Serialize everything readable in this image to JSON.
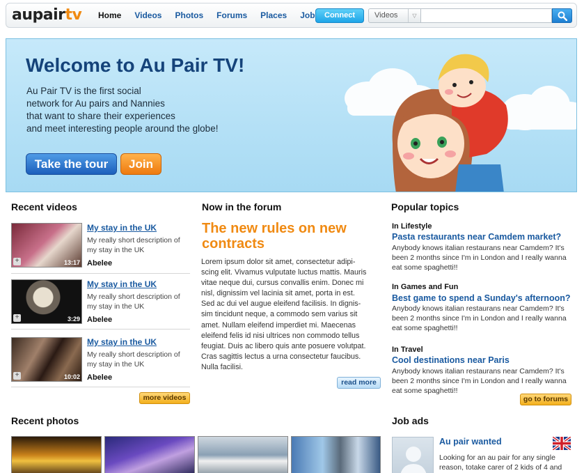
{
  "header": {
    "logo_part1": "aupair",
    "logo_part2": "tv",
    "nav": [
      "Home",
      "Videos",
      "Photos",
      "Forums",
      "Places",
      "Jobs"
    ],
    "connect_label": "Connect",
    "search_type": "Videos"
  },
  "hero": {
    "title": "Welcome to Au Pair TV!",
    "intro": [
      "Au Pair TV is the first social",
      "network for Au pairs and Nannies",
      "that want to share their experiences",
      "and meet interesting people around the globe!"
    ],
    "tour_label": "Take the tour",
    "join_label": "Join"
  },
  "videos": {
    "title": "Recent videos",
    "items": [
      {
        "title": "My stay in the UK",
        "desc": [
          "My really short description of",
          "my stay in the UK"
        ],
        "user": "Abelee",
        "duration": "13:17"
      },
      {
        "title": "My stay in the UK",
        "desc": [
          "My really short description of",
          "my stay in the UK"
        ],
        "user": "Abelee",
        "duration": "3:29"
      },
      {
        "title": "My stay in the UK",
        "desc": [
          "My really short description of",
          "my stay in the UK"
        ],
        "user": "Abelee",
        "duration": "10:02"
      }
    ],
    "more_label": "more videos"
  },
  "forum": {
    "title": "Now in the forum",
    "headline": [
      "The new rules on new",
      "contracts"
    ],
    "body": [
      "Lorem ipsum dolor sit amet, consectetur adipi-",
      "scing elit. Vivamus vulputate luctus mattis. Mauris",
      "vitae neque dui, cursus convallis enim. Donec mi",
      "nisl, dignissim vel lacinia sit amet, porta in est.",
      "Sed ac dui vel augue eleifend facilisis. In dignis-",
      "sim tincidunt neque, a commodo sem varius sit",
      "amet. Nullam eleifend imperdiet mi. Maecenas",
      "eleifend felis id nisi ultrices non commodo tellus",
      "feugiat. Duis ac libero quis ante posuere volutpat.",
      "Cras sagittis lectus a urna consectetur faucibus.",
      "Nulla facilisi."
    ],
    "read_more": "read more"
  },
  "topics": {
    "title": "Popular topics",
    "items": [
      {
        "category": "In Lifestyle",
        "title": "Pasta restaurants near Camdem market?",
        "body": [
          "Anybody knows italian restaurans near Camdem? It's",
          "been 2 months since I'm in London and I really wanna",
          "eat some spaghetti!!"
        ]
      },
      {
        "category": "In Games and Fun",
        "title": "Best game to spend a Sunday's afternoon?",
        "body": [
          "Anybody knows italian restaurans near Camdem? It's",
          "been 2 months since I'm in London and I really wanna",
          "eat some spaghetti!!"
        ]
      },
      {
        "category": "In Travel",
        "title": "Cool destinations near Paris",
        "body": [
          "Anybody knows italian restaurans near Camdem? It's",
          "been 2 months since I'm in London and I really wanna",
          "eat some spaghetti!!"
        ]
      }
    ],
    "more_label": "go to forums"
  },
  "photos": {
    "title": "Recent photos"
  },
  "jobs": {
    "title": "Job ads",
    "item": {
      "title": "Au pair wanted",
      "body": [
        "Looking for an au pair for any single",
        "reason, totake carer of 2 kids of 4 and"
      ]
    }
  }
}
